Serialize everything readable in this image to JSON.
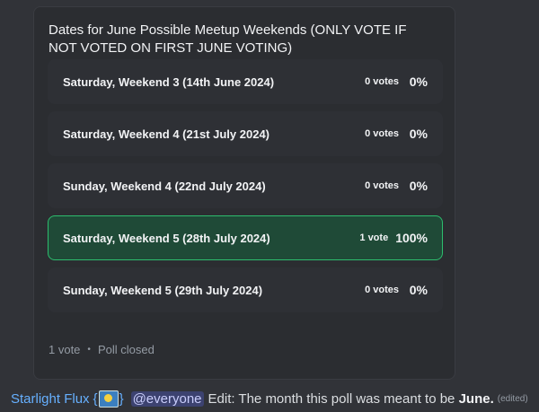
{
  "poll": {
    "question": "Dates for June Possible Meetup Weekends (ONLY VOTE IF NOT VOTED ON FIRST JUNE VOTING)",
    "options": [
      {
        "label": "Saturday, Weekend 3 (14th June 2024)",
        "votes": "0 votes",
        "percent": "0%"
      },
      {
        "label": "Saturday, Weekend 4 (21st July 2024)",
        "votes": "0 votes",
        "percent": "0%"
      },
      {
        "label": "Sunday, Weekend 4 (22nd July 2024)",
        "votes": "0 votes",
        "percent": "0%"
      },
      {
        "label": "Saturday, Weekend 5 (28th July 2024)",
        "votes": "1 vote",
        "percent": "100%"
      },
      {
        "label": "Sunday, Weekend 5 (29th July 2024)",
        "votes": "0 votes",
        "percent": "0%"
      }
    ],
    "total_votes": "1 vote",
    "separator": "•",
    "status": "Poll closed",
    "winner_color": "#2dbd6e"
  },
  "message": {
    "author": "Starlight Flux",
    "brace_open": "{",
    "brace_close": "}",
    "badge_icon": "picture-badge-icon",
    "mention": "@everyone",
    "text_before": "Edit: The month this poll was meant to be",
    "text_bold": "June",
    "text_after": ".",
    "edited": "(edited)"
  }
}
